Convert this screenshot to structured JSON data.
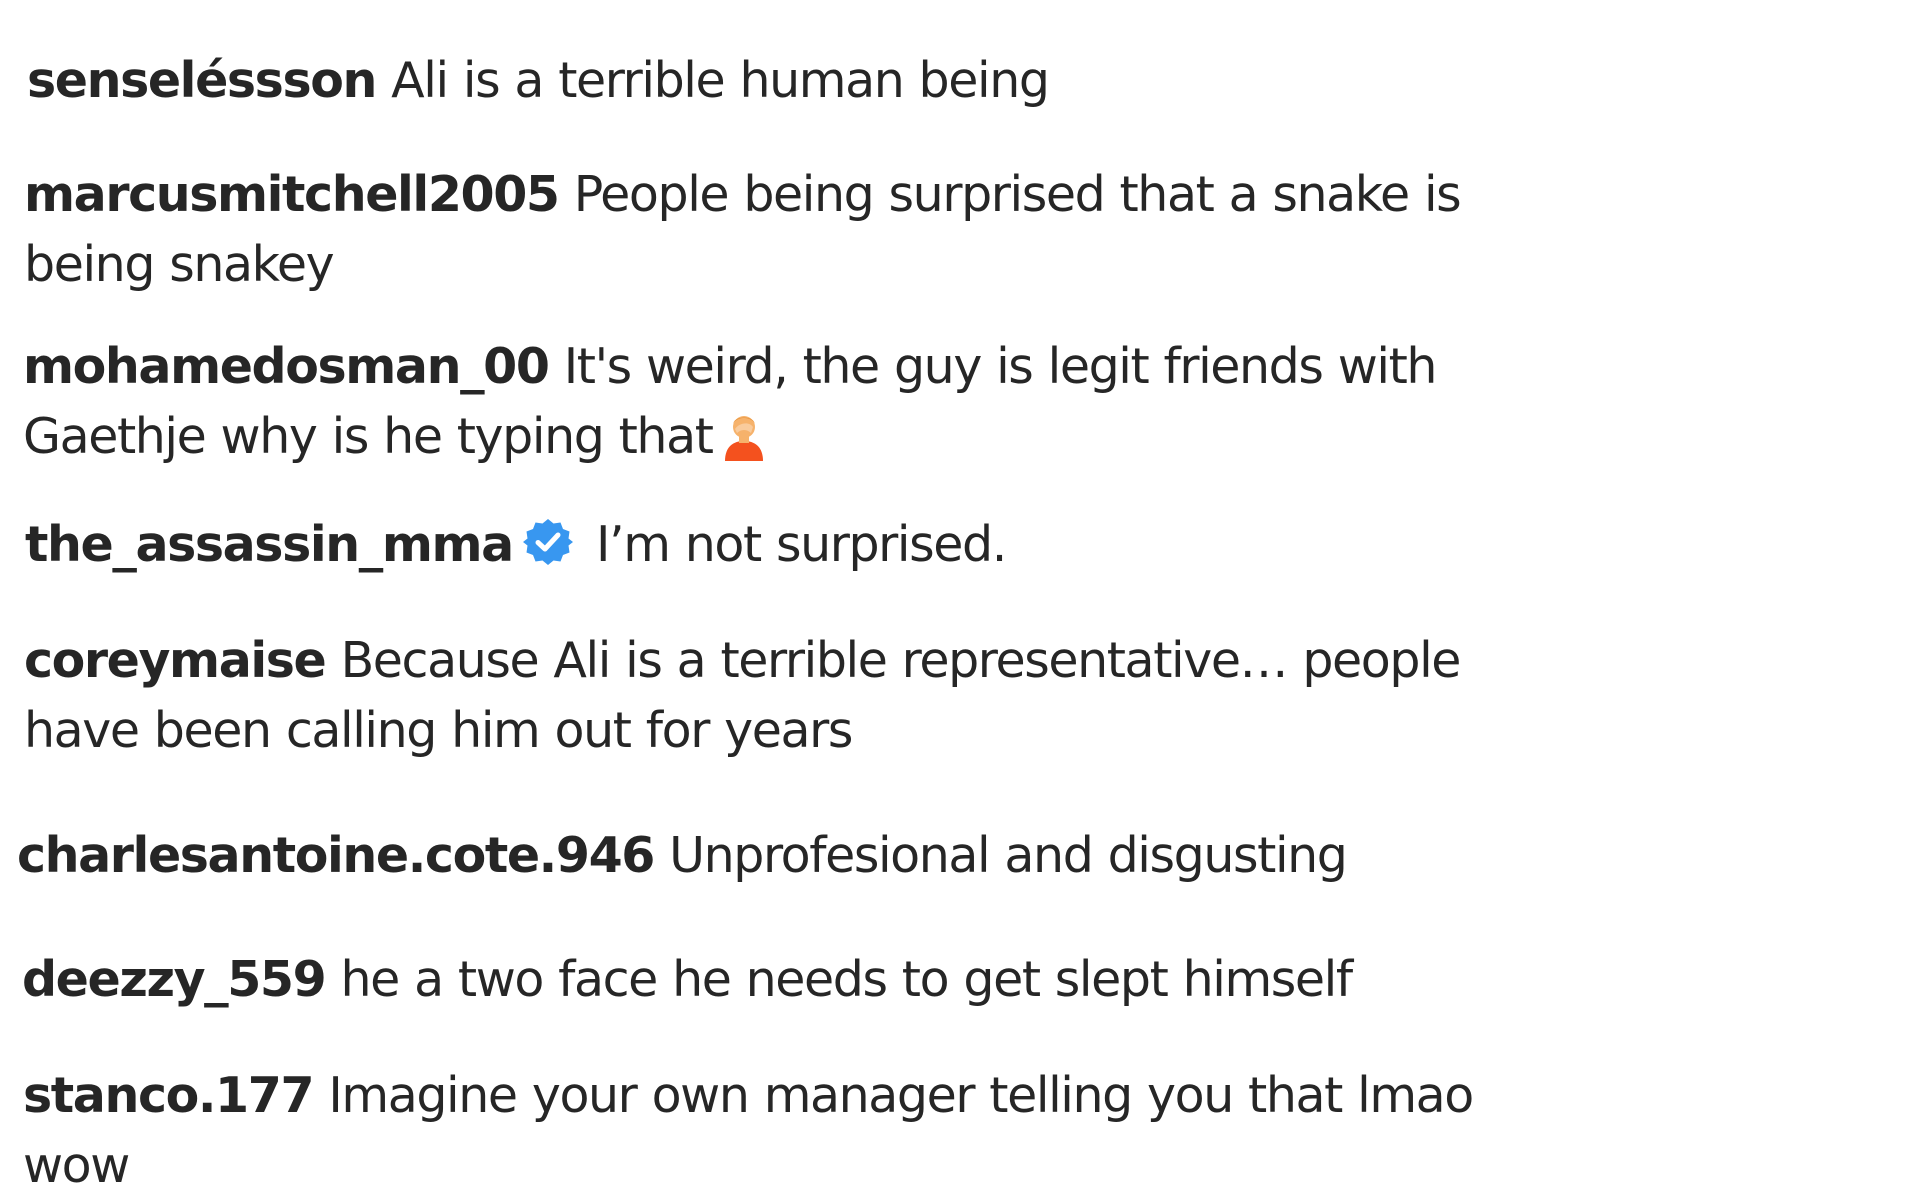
{
  "comments": [
    {
      "username": "senseléssson",
      "text": "Ali is a terrible human being"
    },
    {
      "username": "marcusmitchell2005",
      "text": "People being surprised that a snake is being snakey"
    },
    {
      "username": "mohamedosman_00",
      "text": "It's weird, the guy is legit friends with Gaethje why is he typing that",
      "emoji": "person-facepalming-icon"
    },
    {
      "username": "the_assassin_mma",
      "verified": true,
      "verified_color": "#3897f0",
      "text": "I’m not surprised."
    },
    {
      "username": "coreymaise",
      "text": "Because Ali is a terrible representative… people have been calling him out for years"
    },
    {
      "username": "charlesantoine.cote.946",
      "text": "Unprofesional and disgusting"
    },
    {
      "username": "deezzy_559",
      "text": "he a two face he needs to get slept himself"
    },
    {
      "username": "stanco.177",
      "text": "Imagine your own manager telling you that lmao wow"
    }
  ],
  "colors": {
    "text": "#262626",
    "background": "#ffffff",
    "verified": "#3897f0"
  }
}
